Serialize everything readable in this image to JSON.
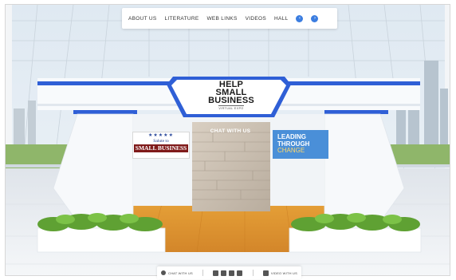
{
  "nav": {
    "links": [
      "ABOUT US",
      "LITERATURE",
      "WEB LINKS",
      "VIDEOS",
      "HALL"
    ],
    "prev_icon": "chevron-left-icon",
    "next_icon": "chevron-right-icon"
  },
  "booth": {
    "header_lines": [
      "HELP",
      "SMALL",
      "BUSINESS"
    ],
    "header_sub": "VIRTUAL EXPO",
    "left_banner": {
      "stars": "★★★★★",
      "salute": "Salute to",
      "title": "SMALL BUSINESS"
    },
    "center_label": "CHAT WITH US",
    "right_banner": [
      "LEADING",
      "THROUGH",
      "CHANGE"
    ]
  },
  "bottom_bar": {
    "chat_label": "CHAT WITH US",
    "video_label": "VIDEO WITH US",
    "social_icons": [
      "facebook-icon",
      "linkedin-icon",
      "twitter-icon",
      "youtube-icon"
    ]
  },
  "colors": {
    "accent_blue": "#3b7de0",
    "booth_blue": "#2f5fd6",
    "banner_red": "#7f1a1a",
    "sign_blue": "#4a8fd8"
  }
}
